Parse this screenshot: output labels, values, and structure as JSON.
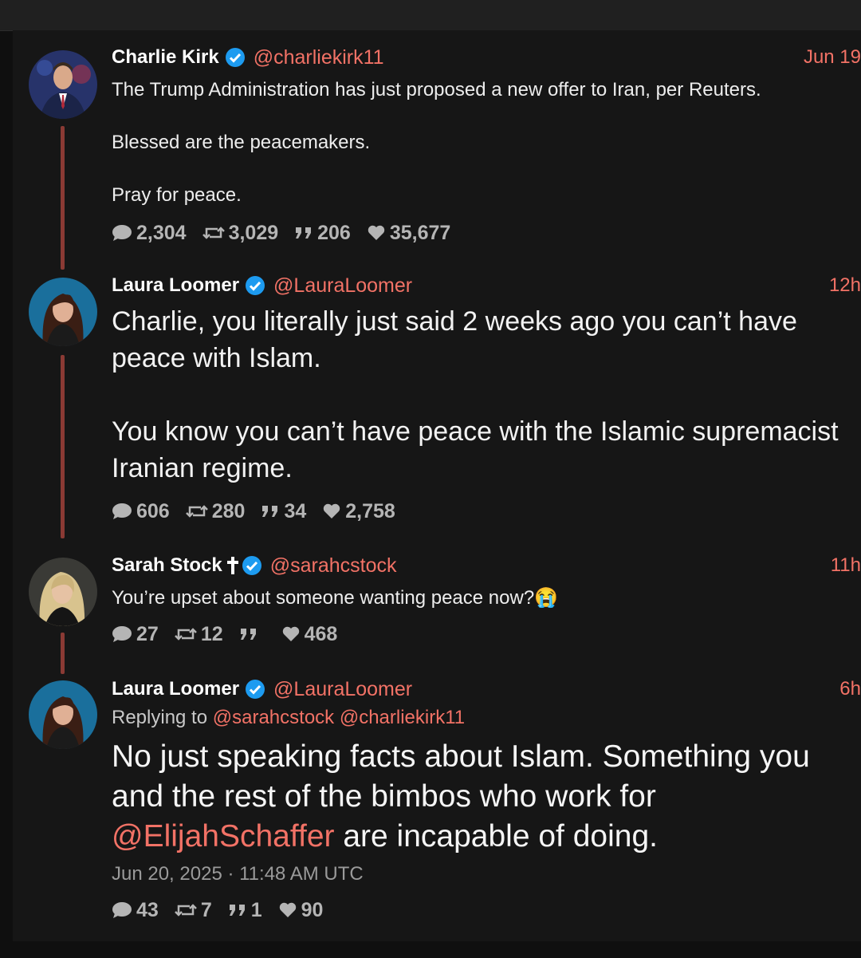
{
  "colors": {
    "accent": "#f27266",
    "rail": "#8a3a34",
    "verified": "#1d9bf0"
  },
  "tweets": [
    {
      "name": "Charlie Kirk",
      "handle": "@charliekirk11",
      "date": "Jun 19",
      "text": "The Trump Administration has just proposed a new offer to Iran, per Reuters.\n\nBlessed are the peacemakers.\n\nPray for peace.",
      "replies": "2,304",
      "retweets": "3,029",
      "quotes": "206",
      "likes": "35,677"
    },
    {
      "name": "Laura Loomer",
      "handle": "@LauraLoomer",
      "date": "12h",
      "text": "Charlie, you literally just said 2 weeks ago you can’t have peace with Islam.\n\nYou know you can’t have peace with the Islamic supremacist Iranian regime.",
      "replies": "606",
      "retweets": "280",
      "quotes": "34",
      "likes": "2,758"
    },
    {
      "name": "Sarah Stock",
      "handle": "@sarahcstock",
      "date": "11h",
      "text": "You’re upset about someone wanting peace now?😭",
      "replies": "27",
      "retweets": "12",
      "quotes": "",
      "likes": "468"
    },
    {
      "name": "Laura Loomer",
      "handle": "@LauraLoomer",
      "date": "6h",
      "replying_label": "Replying to",
      "replying_to": [
        "@sarahcstock",
        "@charliekirk11"
      ],
      "text_before": "No just speaking facts about Islam. Something you and the rest of the bimbos who work for ",
      "text_mention": "@ElijahSchaffer",
      "text_after": " are incapable of doing.",
      "timestamp": "Jun 20, 2025 · 11:48 AM UTC",
      "replies": "43",
      "retweets": "7",
      "quotes": "1",
      "likes": "90"
    }
  ]
}
